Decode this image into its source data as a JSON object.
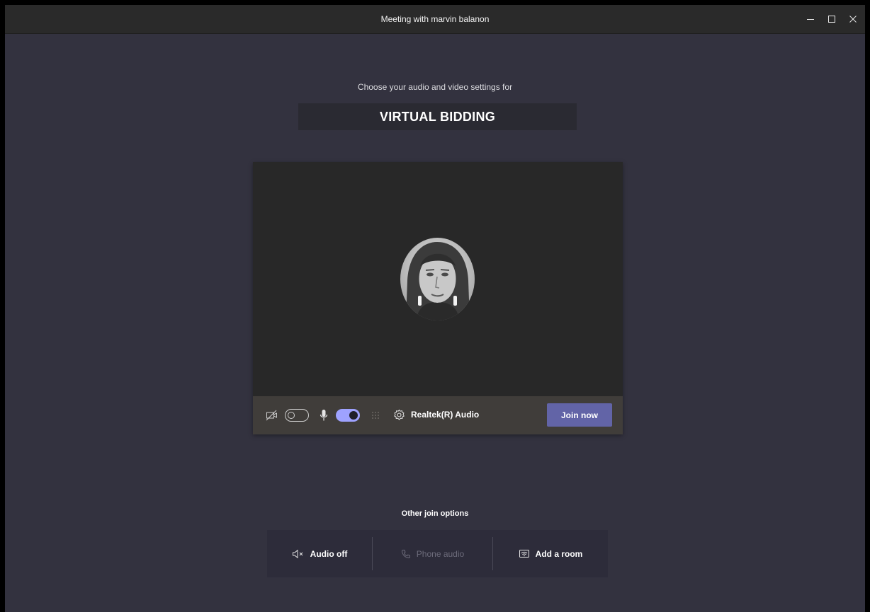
{
  "window": {
    "title": "Meeting with marvin balanon",
    "controls": [
      "minimize-icon",
      "maximize-icon",
      "close-icon"
    ]
  },
  "prejoin": {
    "subtitle": "Choose your audio and video settings for",
    "meeting_name": "VIRTUAL BIDDING",
    "camera": {
      "icon": "camera-off-icon",
      "enabled": false
    },
    "microphone": {
      "icon": "microphone-icon",
      "enabled": true
    },
    "noise_icon": "blur-background-icon",
    "device": {
      "icon": "gear-icon",
      "label": "Realtek(R) Audio"
    },
    "join_label": "Join now"
  },
  "other_options": {
    "heading": "Other join options",
    "items": [
      {
        "icon": "speaker-off-icon",
        "label": "Audio off",
        "enabled": true
      },
      {
        "icon": "phone-icon",
        "label": "Phone audio",
        "enabled": false
      },
      {
        "icon": "cast-room-icon",
        "label": "Add a room",
        "enabled": true
      }
    ]
  },
  "colors": {
    "background": "#33323f",
    "titlebar": "#2a2a2a",
    "accent": "#6264a7",
    "toggle_on": "#9ea2ff",
    "control_bar": "#403d3a"
  }
}
